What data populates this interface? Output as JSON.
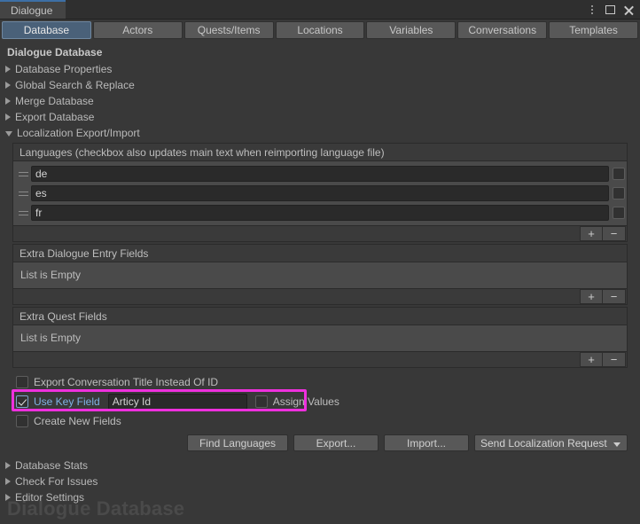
{
  "window": {
    "tab_label": "Dialogue",
    "controls": [
      {
        "name": "kebab-menu-icon",
        "glyph": "⋮"
      },
      {
        "name": "maximize-icon",
        "glyph": "□"
      },
      {
        "name": "close-icon",
        "glyph": "✕"
      }
    ]
  },
  "tabs": [
    {
      "label": "Database",
      "selected": true
    },
    {
      "label": "Actors",
      "selected": false
    },
    {
      "label": "Quests/Items",
      "selected": false
    },
    {
      "label": "Locations",
      "selected": false
    },
    {
      "label": "Variables",
      "selected": false
    },
    {
      "label": "Conversations",
      "selected": false
    },
    {
      "label": "Templates",
      "selected": false
    }
  ],
  "main": {
    "section_title": "Dialogue Database",
    "foldouts_top": [
      {
        "label": "Database Properties",
        "expanded": false
      },
      {
        "label": "Global Search & Replace",
        "expanded": false
      },
      {
        "label": "Merge Database",
        "expanded": false
      },
      {
        "label": "Export Database",
        "expanded": false
      },
      {
        "label": "Localization Export/Import",
        "expanded": true
      }
    ],
    "foldouts_bottom": [
      {
        "label": "Database Stats",
        "expanded": false
      },
      {
        "label": "Check For Issues",
        "expanded": false
      },
      {
        "label": "Editor Settings",
        "expanded": false
      }
    ]
  },
  "languages_list": {
    "header": "Languages (checkbox also updates main text when reimporting language file)",
    "rows": [
      {
        "value": "de",
        "checked": false
      },
      {
        "value": "es",
        "checked": false
      },
      {
        "value": "fr",
        "checked": false
      }
    ],
    "add_label": "+",
    "remove_label": "−"
  },
  "extra_dialogue_fields": {
    "header": "Extra Dialogue Entry Fields",
    "empty_text": "List is Empty",
    "add_label": "+",
    "remove_label": "−"
  },
  "extra_quest_fields": {
    "header": "Extra Quest Fields",
    "empty_text": "List is Empty",
    "add_label": "+",
    "remove_label": "−"
  },
  "options": {
    "export_conversation_title": {
      "label": "Export Conversation Title Instead Of ID",
      "checked": false
    },
    "use_key_field": {
      "label": "Use Key Field",
      "checked": true,
      "highlighted": true
    },
    "key_field_value": "Articy Id",
    "assign_values": {
      "label": "Assign Values",
      "checked": false
    },
    "create_new_fields": {
      "label": "Create New Fields",
      "checked": false
    }
  },
  "actions": {
    "find_languages": "Find Languages",
    "export": "Export...",
    "import": "Import...",
    "localization_request": "Send Localization Request"
  },
  "watermark": "Dialogue Database",
  "colors": {
    "panel_bg": "#383838",
    "tab_selected": "#4a6179",
    "highlight": "#ee30dd",
    "highlight_label": "#7fb2e5",
    "list_body": "#4a4a4a",
    "list_header": "#3a3a3a"
  }
}
